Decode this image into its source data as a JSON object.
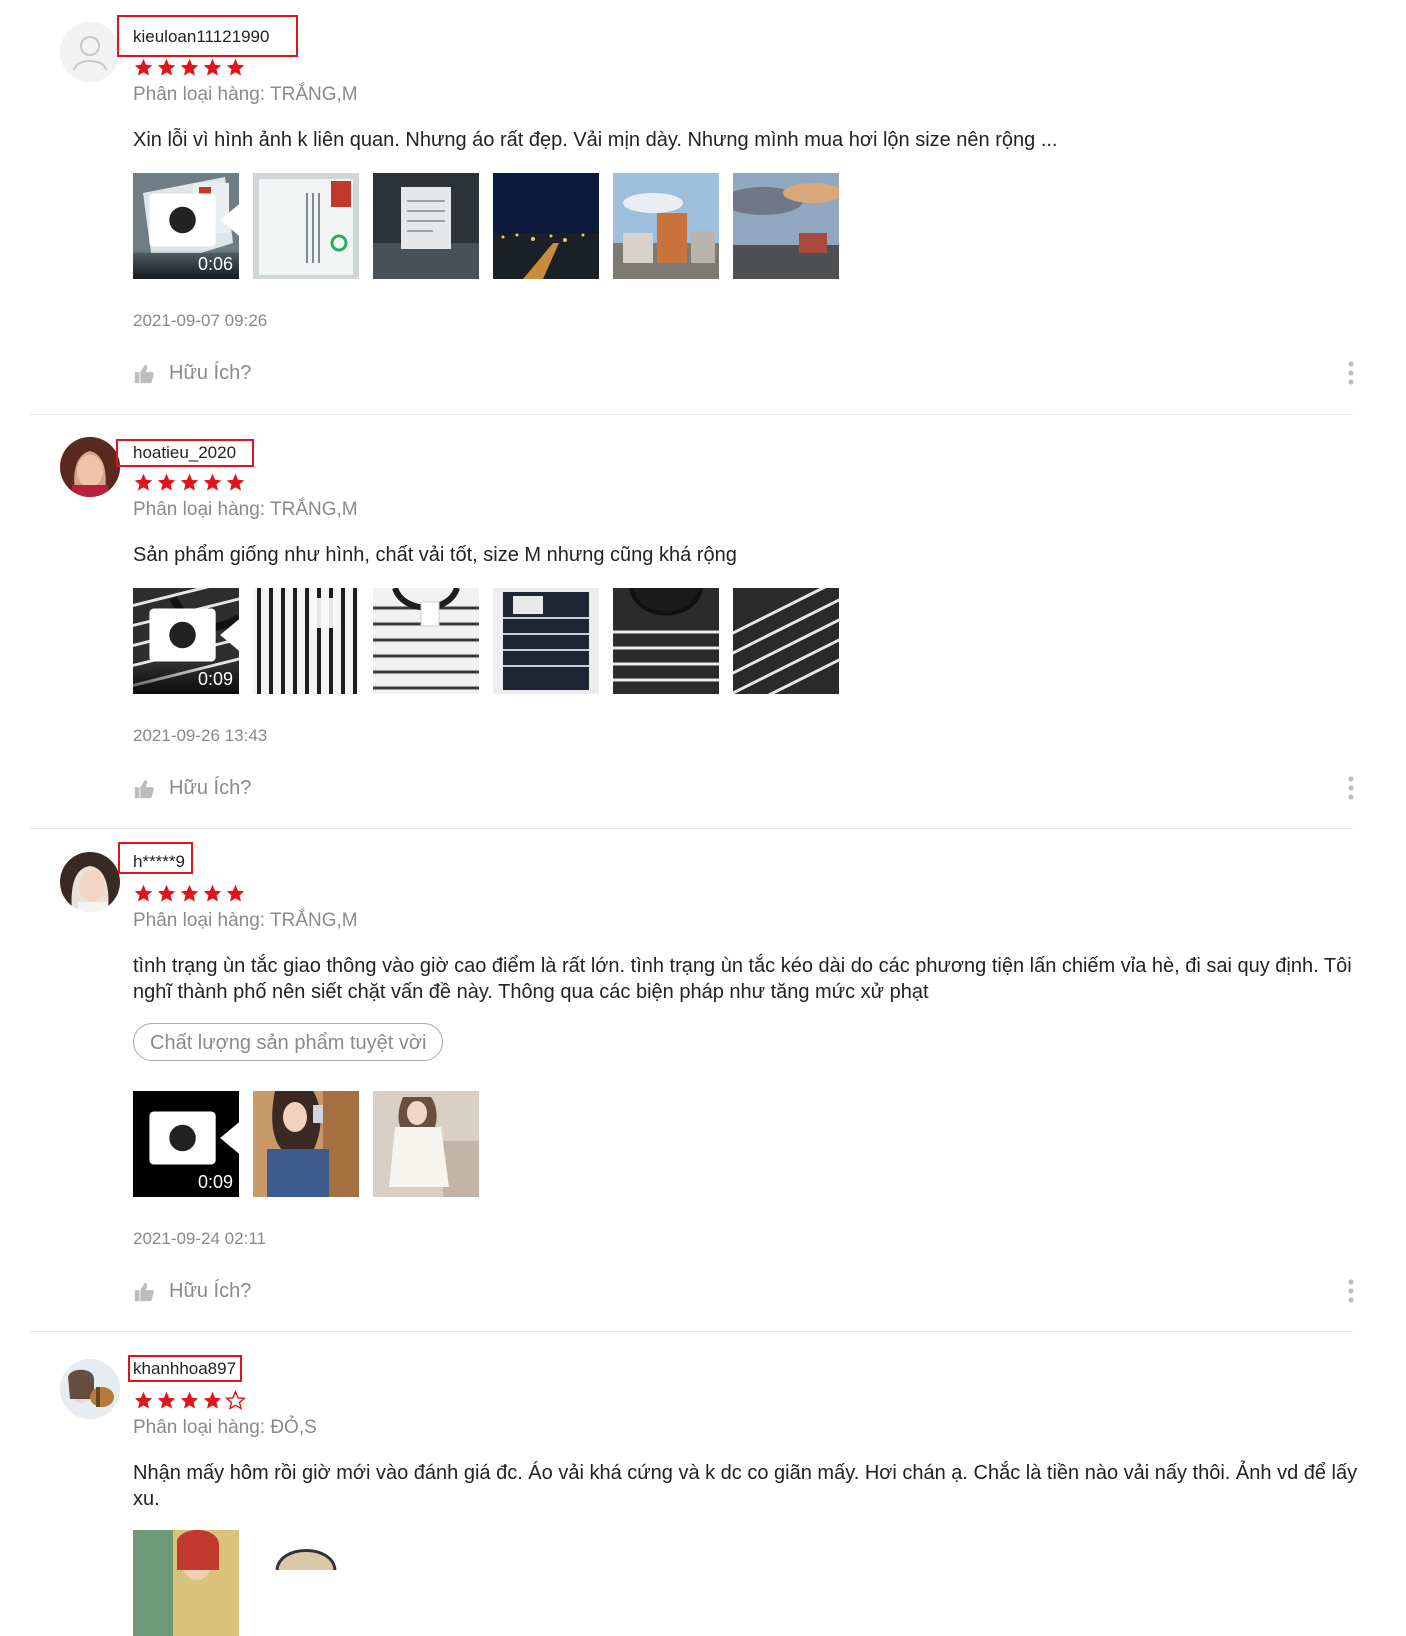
{
  "reviews": [
    {
      "username": "kieuloan11121990",
      "rating": 5,
      "variation": "Phân loại hàng: TRẮNG,M",
      "comment": "Xin lỗi vì hình ảnh k liên quan. Nhưng áo rất đẹp. Vải mịn dày. Nhưng mình mua hơi lộn size nên rộng ...",
      "video_duration": "0:06",
      "date": "2021-09-07 09:26",
      "helpful_label": "Hữu Ích?"
    },
    {
      "username": "hoatieu_2020",
      "rating": 5,
      "variation": "Phân loại hàng: TRẮNG,M",
      "comment": "Sản phẩm giống như hình, chất vải tốt, size M nhưng cũng khá rộng",
      "video_duration": "0:09",
      "date": "2021-09-26 13:43",
      "helpful_label": "Hữu Ích?"
    },
    {
      "username": "h*****9",
      "rating": 5,
      "variation": "Phân loại hàng: TRẮNG,M",
      "comment": "tình trạng ùn tắc giao thông vào giờ cao điểm là rất lớn. tình trạng ùn tắc kéo dài do các phương tiện lấn chiếm vỉa hè, đi sai quy định. Tôi nghĩ thành phố nên siết chặt vấn đề này. Thông qua các biện pháp như tăng mức xử phạt",
      "tag": "Chất lượng sản phẩm tuyệt vời",
      "video_duration": "0:09",
      "date": "2021-09-24 02:11",
      "helpful_label": "Hữu Ích?"
    },
    {
      "username": "khanhhoa897",
      "rating": 4,
      "variation": "Phân loại hàng: ĐỎ,S",
      "comment": "Nhận mấy hôm rồi giờ mới vào đánh giá đc. Áo vải khá cứng và k dc co giãn mấy. Hơi chán ạ. Chắc là tiền nào vải nấy thôi. Ảnh vd để lấy xu."
    }
  ],
  "colors": {
    "star": "#e1141b",
    "highlight_box": "#e1141b",
    "muted_text": "#8a8a8a"
  }
}
